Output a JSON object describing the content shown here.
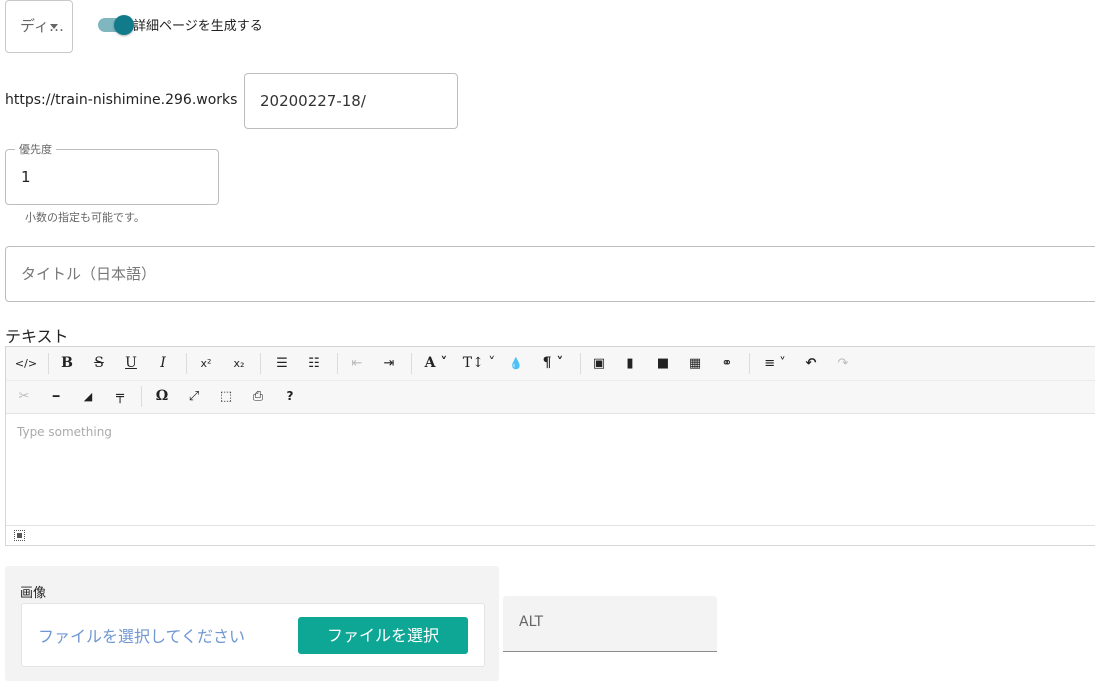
{
  "top": {
    "select_value": "ディ…",
    "toggle_label": "詳細ページを生成する",
    "toggle_on": true
  },
  "url": {
    "prefix": "https://train-nishimine.296.works",
    "slug_value": "20200227-18/"
  },
  "priority": {
    "label": "優先度",
    "value": "1",
    "hint": "小数の指定も可能です。"
  },
  "title_field": {
    "placeholder": "タイトル（日本語）"
  },
  "editor": {
    "label": "テキスト",
    "placeholder": "Type something",
    "toolbar_row1": [
      {
        "name": "code-view-icon",
        "glyph": "</>"
      },
      {
        "name": "bold-icon",
        "glyph": "B"
      },
      {
        "name": "strikethrough-icon",
        "glyph": "S"
      },
      {
        "name": "underline-icon",
        "glyph": "U"
      },
      {
        "name": "italic-icon",
        "glyph": "I"
      },
      {
        "name": "superscript-icon",
        "glyph": "x²"
      },
      {
        "name": "subscript-icon",
        "glyph": "x₂"
      },
      {
        "name": "bullet-list-icon",
        "glyph": "☰"
      },
      {
        "name": "numbered-list-icon",
        "glyph": "☷"
      },
      {
        "name": "outdent-icon",
        "glyph": "⇤"
      },
      {
        "name": "indent-icon",
        "glyph": "⇥"
      },
      {
        "name": "font-family-icon",
        "glyph": "A ˅"
      },
      {
        "name": "font-size-icon",
        "glyph": "T↕ ˅"
      },
      {
        "name": "color-icon",
        "glyph": "💧"
      },
      {
        "name": "paragraph-icon",
        "glyph": "¶ ˅"
      },
      {
        "name": "image-icon",
        "glyph": "▣"
      },
      {
        "name": "file-icon",
        "glyph": "▮"
      },
      {
        "name": "video-icon",
        "glyph": "■"
      },
      {
        "name": "table-icon",
        "glyph": "▦"
      },
      {
        "name": "link-icon",
        "glyph": "⚭"
      },
      {
        "name": "align-icon",
        "glyph": "≡ ˅"
      },
      {
        "name": "undo-icon",
        "glyph": "↶"
      },
      {
        "name": "redo-icon",
        "glyph": "↷"
      }
    ],
    "toolbar_row2": [
      {
        "name": "cut-icon",
        "glyph": "✂"
      },
      {
        "name": "horizontal-rule-icon",
        "glyph": "━"
      },
      {
        "name": "eraser-icon",
        "glyph": "◢"
      },
      {
        "name": "format-painter-icon",
        "glyph": "╤"
      },
      {
        "name": "special-char-icon",
        "glyph": "Ω"
      },
      {
        "name": "fullscreen-icon",
        "glyph": "⤢"
      },
      {
        "name": "select-all-icon",
        "glyph": "⬚"
      },
      {
        "name": "print-icon",
        "glyph": "⎙"
      },
      {
        "name": "help-icon",
        "glyph": "?"
      }
    ]
  },
  "image_section": {
    "label": "画像",
    "file_placeholder": "ファイルを選択してください",
    "file_button": "ファイルを選択",
    "alt_placeholder": "ALT"
  },
  "colors": {
    "toggle_on": "#117a8b",
    "file_button": "#0ea796",
    "file_placeholder": "#6f97d1"
  }
}
